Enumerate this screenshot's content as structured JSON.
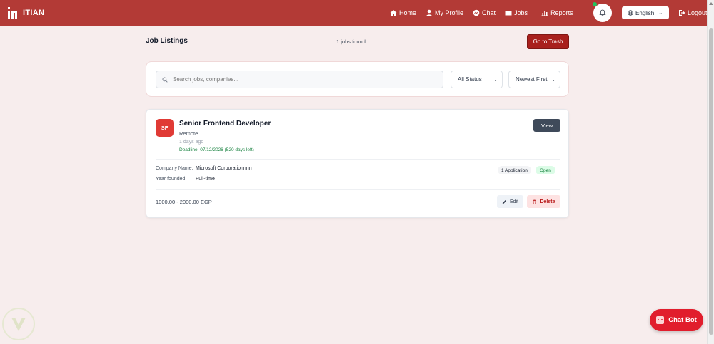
{
  "brand": {
    "name": "ITIAN"
  },
  "nav": {
    "home": "Home",
    "profile": "My Profile",
    "chat": "Chat",
    "jobs": "Jobs",
    "reports": "Reports",
    "language": "English",
    "logout": "Logout"
  },
  "header": {
    "title": "Job Listings",
    "jobs_found": "1 jobs found",
    "trash_button": "Go to Trash"
  },
  "filters": {
    "search_placeholder": "Search jobs, companies...",
    "status_selected": "All Status",
    "sort_selected": "Newest First"
  },
  "job": {
    "avatar": "SF",
    "title": "Senior Frontend Developer",
    "location": "Remote",
    "posted": "1 days ago",
    "deadline": "Deadline: 07/12/2026 (520 days left)",
    "view_button": "View",
    "company_label": "Company Name:",
    "company_value": "Microsoft Corporationnnn",
    "founded_label": "Year founded:",
    "founded_value": "Full-time",
    "applications": "1 Application",
    "status": "Open",
    "salary": "1000.00 - 2000.00 EGP",
    "edit_button": "Edit",
    "delete_button": "Delete"
  },
  "chatbot": {
    "label": "Chat Bot"
  },
  "colors": {
    "brand": "#b33a36",
    "trash": "#a8201d",
    "avatar": "#e03a35",
    "view": "#3f4a5a",
    "open": "#15803d",
    "chatbot": "#e11d2c"
  }
}
